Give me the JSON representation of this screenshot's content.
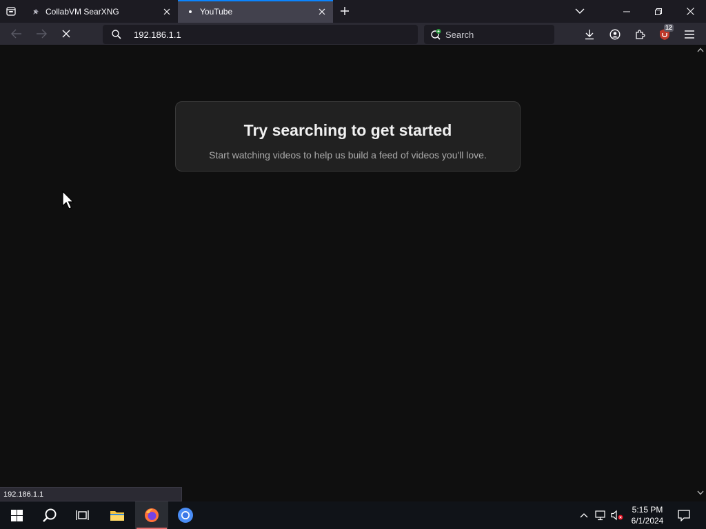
{
  "browser": {
    "tabs": [
      {
        "title": "CollabVM SearXNG",
        "active": false
      },
      {
        "title": "YouTube",
        "active": true
      }
    ],
    "url": "192.186.1.1",
    "search_placeholder": "Search",
    "extension_badge": "12"
  },
  "page": {
    "heading": "Try searching to get started",
    "subtext": "Start watching videos to help us build a feed of videos you'll love."
  },
  "status_bar": {
    "link": "192.186.1.1"
  },
  "taskbar": {
    "time": "5:15 PM",
    "date": "6/1/2024"
  },
  "colors": {
    "accent": "#0a84ff",
    "page_bg": "#0f0f0f",
    "card_bg": "#212121",
    "ublock_red": "#c0392b"
  }
}
